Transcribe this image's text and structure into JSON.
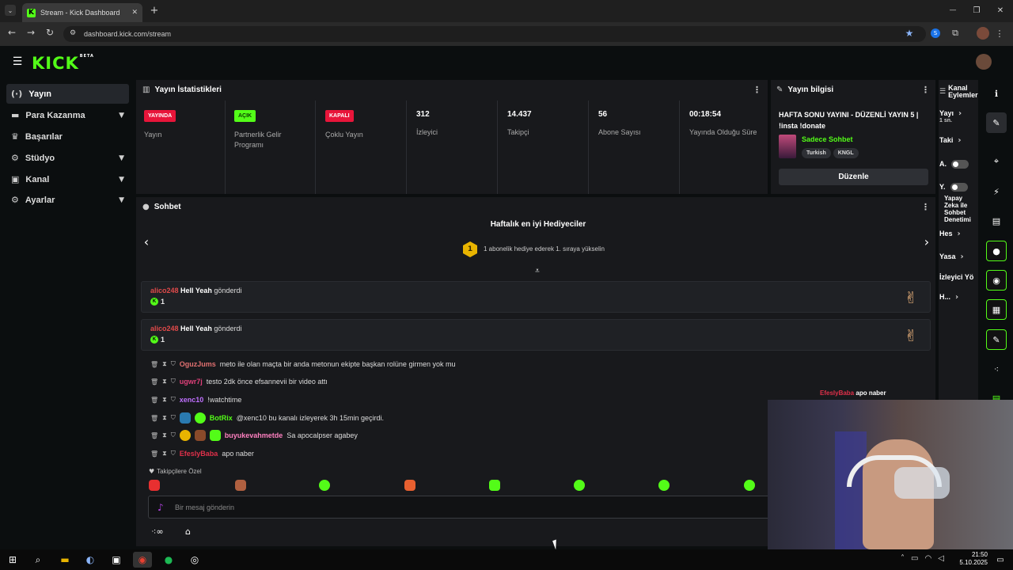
{
  "browser": {
    "tab_title": "Stream - Kick Dashboard",
    "url": "dashboard.kick.com/stream",
    "new_tab": "+",
    "min": "—",
    "restore": "❐",
    "close": "✕"
  },
  "app": {
    "logo": "KICK",
    "logo_beta": "BETA"
  },
  "sidebar": {
    "items": [
      {
        "label": "Yayın",
        "icon": "broadcast-icon",
        "expandable": false,
        "active": true
      },
      {
        "label": "Para Kazanma",
        "icon": "money-icon",
        "expandable": true
      },
      {
        "label": "Başarılar",
        "icon": "trophy-icon",
        "expandable": false
      },
      {
        "label": "Stüdyo",
        "icon": "gear-icon",
        "expandable": true
      },
      {
        "label": "Kanal",
        "icon": "channel-icon",
        "expandable": true
      },
      {
        "label": "Ayarlar",
        "icon": "gear-icon",
        "expandable": true
      }
    ]
  },
  "stats": {
    "title": "Yayın İstatistikleri",
    "cells": [
      {
        "badge": "YAYINDA",
        "badge_color": "#e8153a",
        "label": "Yayın"
      },
      {
        "badge": "AÇIK",
        "badge_color": "#53fc18",
        "label": "Partnerlik Gelir Programı"
      },
      {
        "badge": "KAPALI",
        "badge_color": "#e8153a",
        "label": "Çoklu Yayın"
      },
      {
        "value": "312",
        "label": "İzleyici"
      },
      {
        "value": "14.437",
        "label": "Takipçi"
      },
      {
        "value": "56",
        "label": "Abone Sayısı"
      },
      {
        "value": "00:18:54",
        "label": "Yayında Olduğu Süre"
      }
    ]
  },
  "info": {
    "title": "Yayın bilgisi",
    "stream_title": "HAFTA SONU YAYINI - DÜZENLİ YAYIN 5 | !insta !donate",
    "category": "Sadece Sohbet",
    "tags": [
      "Turkish",
      "KNGL"
    ],
    "edit_button": "Düzenle"
  },
  "channel_actions": {
    "title": "Kanal Eylemleri",
    "items": [
      {
        "label": "Yayı",
        "sub": "1 sn."
      },
      {
        "label": "Taki"
      },
      {
        "label": "A.",
        "toggle": true
      },
      {
        "label": "Y.",
        "toggle": true
      },
      {
        "label": "Yapay Zeka ile Sohbet Denetimi"
      },
      {
        "label": "Hes"
      },
      {
        "label": "Yasa"
      },
      {
        "label": "İzleyici Yö"
      },
      {
        "label": "H..."
      }
    ]
  },
  "chat": {
    "title": "Sohbet",
    "weekly_title": "Haftalık en iyi Hediyeciler",
    "weekly_rank": "1",
    "weekly_desc": "1 abonelik hediye ederek 1. sıraya yükselin",
    "gifts": [
      {
        "user": "alico248",
        "item": "Hell Yeah",
        "text": "gönderdi",
        "amount": "1"
      },
      {
        "user": "alico248",
        "item": "Hell Yeah",
        "text": "gönderdi",
        "amount": "1"
      }
    ],
    "messages": [
      {
        "user": "OguzJums",
        "color": "#e07070",
        "text": "meto ile olan maçta bir anda metonun ekipte başkan rolüne girmen yok mu"
      },
      {
        "user": "ugwr7j",
        "color": "#e0407a",
        "text": "testo 2dk önce efsannevii bir video attı"
      },
      {
        "user": "xenc10",
        "color": "#c070ff",
        "text": "!watchtime"
      },
      {
        "user": "BotRix",
        "color": "#53fc18",
        "text": "@xenc10 bu kanalı izleyerek 3h 15min geçirdi."
      },
      {
        "user": "buyukevahmetde",
        "color": "#ff80c0",
        "text": "Sa apocalpser agabey"
      },
      {
        "user": "EfeslyBaba",
        "color": "#e0304a",
        "text": "apo naber"
      }
    ],
    "overlay_msg": {
      "user": "EfeslyBaba",
      "text": "apo naber"
    },
    "follower_emotes_label": "Takipçilere Özel",
    "input_placeholder": "Bir mesaj gönderin"
  },
  "taskbar": {
    "time": "21:50",
    "date": "5.10.2025"
  },
  "colors": {
    "accent": "#53fc18",
    "live": "#e8153a"
  }
}
